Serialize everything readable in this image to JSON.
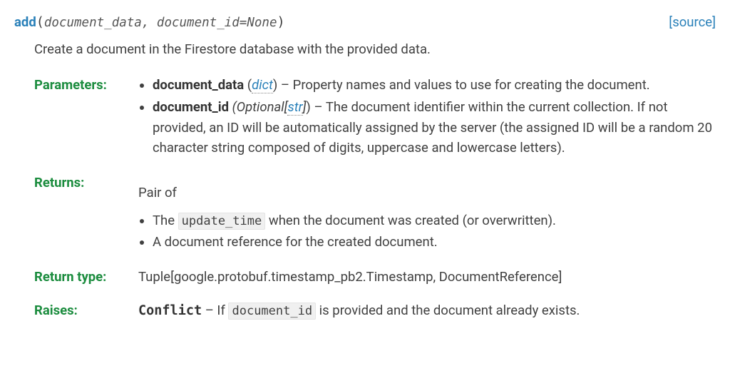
{
  "method": {
    "name": "add",
    "paren_open": "(",
    "paren_close": ")",
    "signature_params": "document_data, document_id=None",
    "source_label": "source"
  },
  "summary": "Create a document in the Firestore database with the provided data.",
  "labels": {
    "parameters": "Parameters:",
    "returns": "Returns:",
    "return_type": "Return type:",
    "raises": "Raises:"
  },
  "parameters": [
    {
      "name": "document_data",
      "type_text": "dict",
      "desc_pre": " (",
      "desc_post": ") – Property names and values to use for creating the document."
    },
    {
      "name": "document_id",
      "optional_prefix": " (Optional[",
      "type_text": "str",
      "optional_suffix": "]) – The document identifier within the current collection. If not provided, an ID will be automatically assigned by the server (the assigned ID will be a random 20 character string composed of digits, uppercase and lowercase letters)."
    }
  ],
  "returns": {
    "intro": "Pair of",
    "items": [
      {
        "pre": "The ",
        "code": "update_time",
        "post": " when the document was created (or overwritten)."
      },
      {
        "pre": "A document reference for the created document.",
        "code": "",
        "post": ""
      }
    ]
  },
  "return_type": "Tuple[google.protobuf.timestamp_pb2.Timestamp, DocumentReference]",
  "raises": {
    "exception": "Conflict",
    "dash": " – If ",
    "code": "document_id",
    "post": " is provided and the document already exists."
  }
}
